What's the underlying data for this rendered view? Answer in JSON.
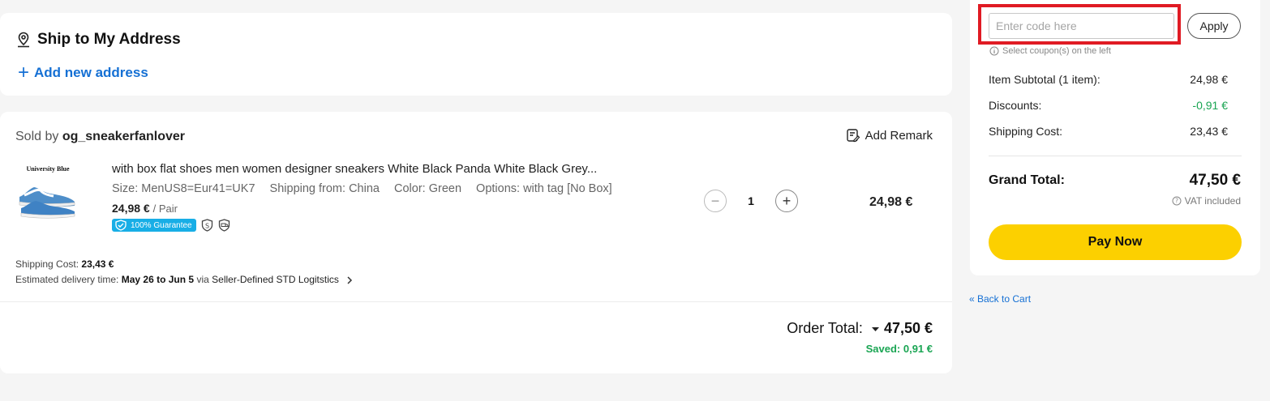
{
  "address": {
    "title": "Ship to My Address",
    "add_label": "Add new address"
  },
  "seller": {
    "sold_by_label": "Sold by",
    "name": "og_sneakerfanlover",
    "remark_label": "Add Remark"
  },
  "product": {
    "image_brand": "University Blue",
    "title": "with box flat shoes men women designer sneakers White Black Panda White Black Grey...",
    "size": "Size: MenUS8=Eur41=UK7",
    "shipping_from": "Shipping from: China",
    "color": "Color: Green",
    "options": "Options: with tag [No Box]",
    "price": "24,98 €",
    "unit": "/ Pair",
    "guarantee": "100% Guarantee",
    "quantity": "1",
    "line_total": "24,98 €"
  },
  "shipping": {
    "cost_label": "Shipping Cost:",
    "cost_value": "23,43 €",
    "delivery_label": "Estimated delivery time:",
    "delivery_value": "May 26 to Jun 5",
    "via": "via",
    "method": "Seller-Defined STD Logitstics"
  },
  "order": {
    "total_label": "Order Total:",
    "total_value": "47,50 €",
    "saved": "Saved: 0,91 €"
  },
  "summary": {
    "coupon_placeholder": "Enter code here",
    "apply_label": "Apply",
    "coupon_hint": "Select coupon(s) on the left",
    "subtotal_label": "Item Subtotal (1 item):",
    "subtotal_value": "24,98 €",
    "discounts_label": "Discounts:",
    "discounts_value": "-0,91 €",
    "shipping_label": "Shipping Cost:",
    "shipping_value": "23,43 €",
    "grand_label": "Grand Total:",
    "grand_value": "47,50 €",
    "vat": "VAT included",
    "pay_label": "Pay Now",
    "back_label": "« Back to Cart"
  },
  "colors": {
    "accent_blue": "#1570d4",
    "pay_yellow": "#fcd000",
    "discount_green": "#1aa553",
    "highlight_red": "#e01b24"
  }
}
